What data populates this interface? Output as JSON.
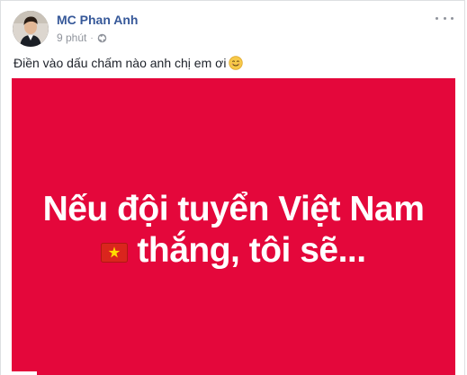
{
  "post": {
    "author_name": "MC Phan Anh",
    "timestamp": "9 phút",
    "separator": "·",
    "privacy_icon": "globe-icon",
    "more_icon": "ellipsis-icon",
    "status_text": "Điền vào dấu chấm nào anh chị em ơi",
    "status_emoji": "smiling-face-icon"
  },
  "image": {
    "line1": "Nếu đội tuyển Việt Nam",
    "line2": "thắng, tôi sẽ...",
    "flag_icon": "vietnam-flag-icon",
    "background_color": "#e4073b",
    "text_color": "#ffffff"
  },
  "colors": {
    "author_link": "#365899",
    "meta": "#90949c"
  }
}
